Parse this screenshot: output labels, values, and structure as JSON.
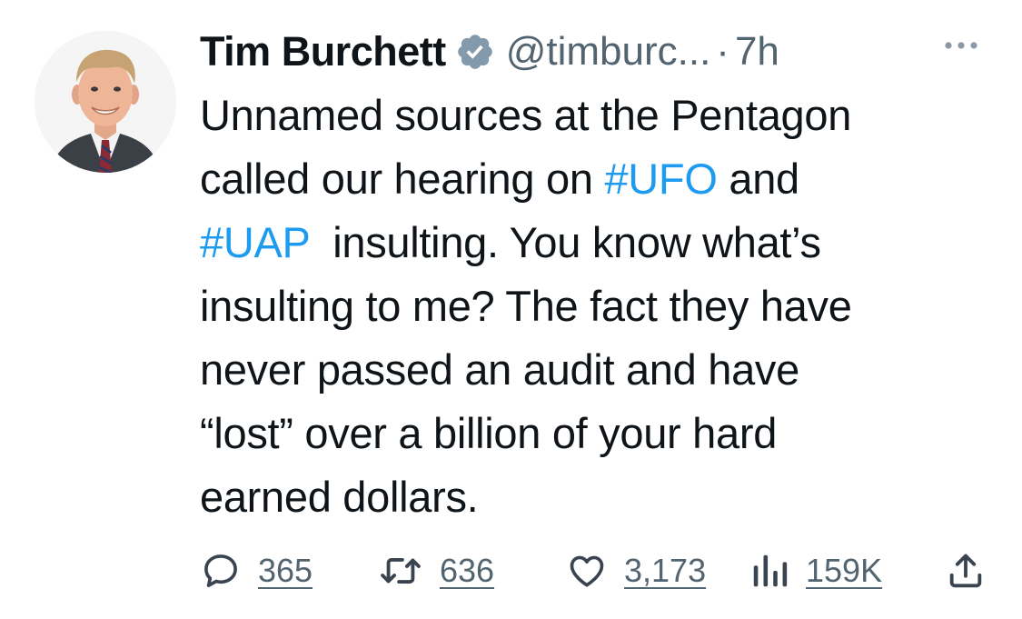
{
  "author": {
    "name": "Tim Burchett",
    "handle": "@timburc...",
    "separator": "·",
    "time": "7h",
    "verified": true,
    "avatar_icon": "profile-photo"
  },
  "tweet": {
    "lines": [
      [
        {
          "text": "Unnamed sources at the Pentagon"
        }
      ],
      [
        {
          "text": "called our hearing on "
        },
        {
          "text": "#UFO",
          "hashtag": true
        },
        {
          "text": " and"
        }
      ],
      [
        {
          "text": "#UAP",
          "hashtag": true
        },
        {
          "text": "  insulting. You know what’s"
        }
      ],
      [
        {
          "text": "insulting to me? The fact they have"
        }
      ],
      [
        {
          "text": "never passed an audit and have"
        }
      ],
      [
        {
          "text": "“lost” over a billion of your hard"
        }
      ],
      [
        {
          "text": "earned dollars."
        }
      ]
    ]
  },
  "actions": {
    "replies": "365",
    "retweets": "636",
    "likes": "3,173",
    "views": "159K"
  },
  "colors": {
    "text": "#0f1419",
    "secondary": "#536471",
    "link": "#1d9bf0",
    "verified_badge": "#829aab"
  }
}
